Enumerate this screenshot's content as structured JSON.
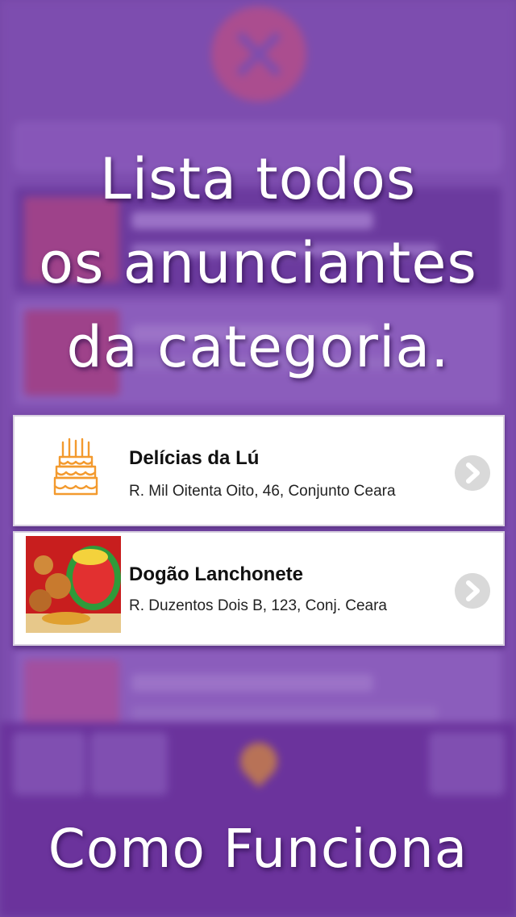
{
  "headline": {
    "line1": "Lista todos",
    "line2": "os anunciantes",
    "line3": "da categoria."
  },
  "listings": [
    {
      "name": "Delícias da Lú",
      "address": "R. Mil Oitenta Oito, 46, Conjunto Ceara",
      "icon": "cake-icon"
    },
    {
      "name": "Dogão Lanchonete",
      "address": "R. Duzentos Dois B, 123, Conj. Ceara",
      "icon": "restaurant-photo"
    }
  ],
  "footer": {
    "title": "Como Funciona"
  },
  "colors": {
    "background": "#8656b2",
    "bottom_bar": "#6a2f96",
    "cake_icon": "#f39a2e",
    "chevron": "#d9d9d9"
  }
}
